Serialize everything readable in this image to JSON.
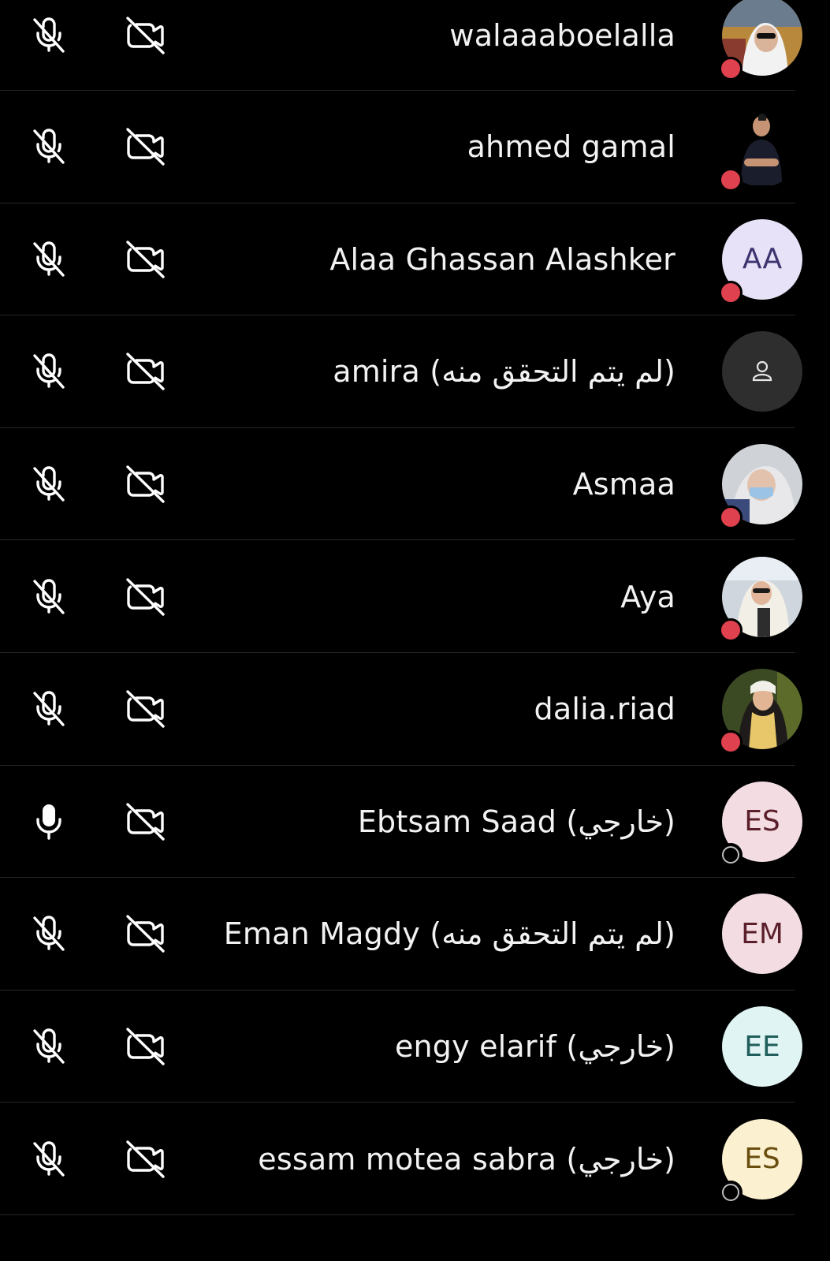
{
  "participants": [
    {
      "name": "walaaaboelalla",
      "mic": "muted",
      "camera": "off",
      "avatar": {
        "type": "photo",
        "photo": "woman-hijab-sunglasses"
      },
      "status": "busy"
    },
    {
      "name": "ahmed gamal",
      "mic": "muted",
      "camera": "off",
      "avatar": {
        "type": "photo",
        "photo": "man-arms-crossed"
      },
      "status": "busy"
    },
    {
      "name": "Alaa Ghassan Alashker",
      "mic": "muted",
      "camera": "off",
      "avatar": {
        "type": "initials",
        "initials": "AA",
        "bg": "#e7e2f7",
        "fg": "#3d3470"
      },
      "status": "busy"
    },
    {
      "name": "amira (لم يتم التحقق منه)",
      "mic": "muted",
      "camera": "off",
      "avatar": {
        "type": "generic",
        "bg": "#2e2e2e",
        "icon": "person-icon"
      },
      "status": "none"
    },
    {
      "name": "Asmaa",
      "mic": "muted",
      "camera": "off",
      "avatar": {
        "type": "photo",
        "photo": "woman-mask"
      },
      "status": "busy"
    },
    {
      "name": "Aya",
      "mic": "muted",
      "camera": "off",
      "avatar": {
        "type": "photo",
        "photo": "woman-scarf-sunglasses"
      },
      "status": "busy"
    },
    {
      "name": "dalia.riad",
      "mic": "muted",
      "camera": "off",
      "avatar": {
        "type": "photo",
        "photo": "woman-yellow-scarf"
      },
      "status": "busy"
    },
    {
      "name": "Ebtsam Saad (خارجي)",
      "mic": "on",
      "camera": "off",
      "avatar": {
        "type": "initials",
        "initials": "ES",
        "bg": "#f3dde2",
        "fg": "#5a1f2a"
      },
      "status": "away"
    },
    {
      "name": "Eman Magdy (لم يتم التحقق منه)",
      "mic": "muted",
      "camera": "off",
      "avatar": {
        "type": "initials",
        "initials": "EM",
        "bg": "#f3dde2",
        "fg": "#5a1f2a"
      },
      "status": "none"
    },
    {
      "name": "engy elarif (خارجي)",
      "mic": "muted",
      "camera": "off",
      "avatar": {
        "type": "initials",
        "initials": "EE",
        "bg": "#dff4f3",
        "fg": "#1f5e5b"
      },
      "status": "none"
    },
    {
      "name": "essam motea sabra (خارجي)",
      "mic": "muted",
      "camera": "off",
      "avatar": {
        "type": "initials",
        "initials": "ES",
        "bg": "#fbf0cf",
        "fg": "#6a4e0e"
      },
      "status": "away"
    }
  ]
}
